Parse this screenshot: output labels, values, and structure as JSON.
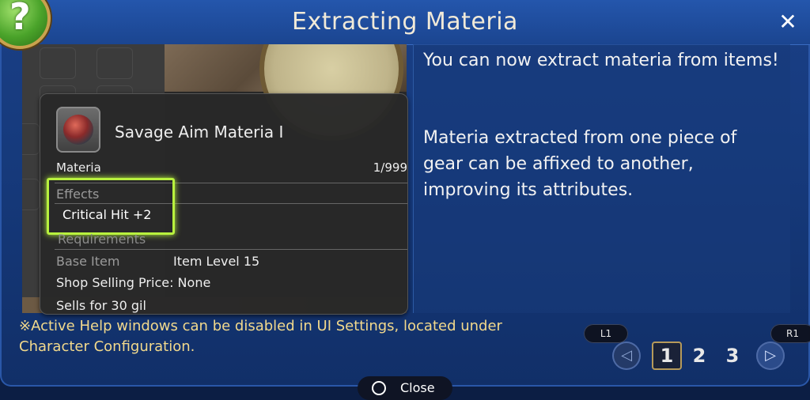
{
  "window": {
    "title": "Extracting Materia"
  },
  "help_badge": {
    "glyph": "?"
  },
  "close_glyph": "✕",
  "tooltip": {
    "item_name": "Savage Aim Materia I",
    "category": "Materia",
    "count": "1/999",
    "effects_label": "Effects",
    "effect_value": "Critical Hit +2",
    "requirements_label": "Requirements",
    "base_item_label": "Base Item",
    "base_item_value": "Item Level 15",
    "shop_price": "Shop Selling Price: None",
    "sells_for": "Sells for 30 gil"
  },
  "help_text": {
    "para1": "You can now extract materia from items!",
    "para2": "Materia extracted from one piece of gear can be affixed to another, improving its attributes."
  },
  "footer_note": "※Active Help windows can be disabled in UI Settings, located under Character Configuration.",
  "pager": {
    "left_tag": "L1",
    "right_tag": "R1",
    "pages": [
      "1",
      "2",
      "3"
    ],
    "active_page": "1",
    "prev_glyph": "◁",
    "next_glyph": "▷"
  },
  "close_button": {
    "label": "Close"
  },
  "colors": {
    "highlight": "#b8f23e",
    "footer_text": "#f2d98c",
    "title_text": "#f1ead8"
  }
}
